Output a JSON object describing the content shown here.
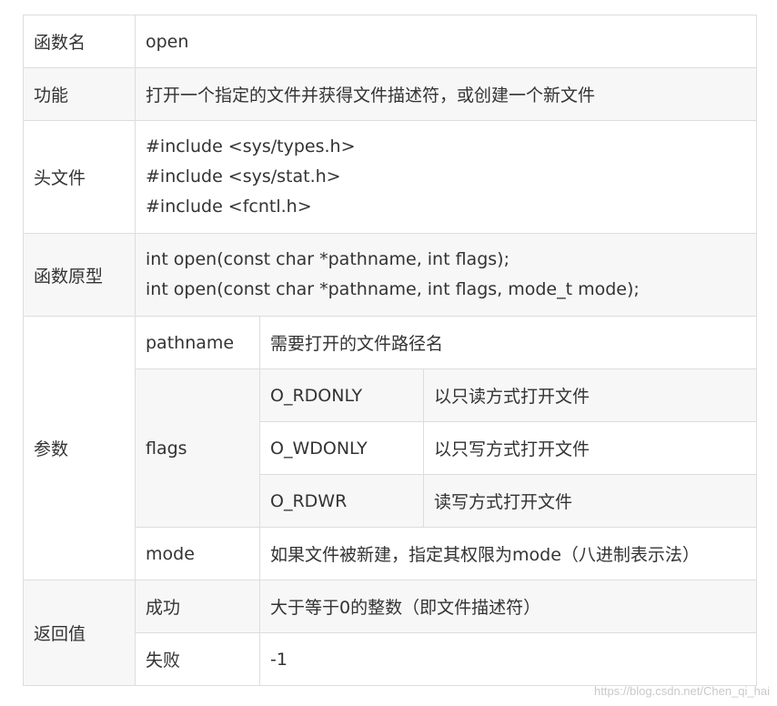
{
  "rows": {
    "name": {
      "label": "函数名",
      "value": "open"
    },
    "function": {
      "label": "功能",
      "value": "打开一个指定的文件并获得文件描述符，或创建一个新文件"
    },
    "headers": {
      "label": "头文件",
      "lines": [
        "#include <sys/types.h>",
        "#include <sys/stat.h>",
        "#include <fcntl.h>"
      ]
    },
    "prototype": {
      "label": "函数原型",
      "lines": [
        "int open(const char *pathname, int flags);",
        "int open(const char *pathname, int flags, mode_t mode);"
      ]
    },
    "params": {
      "label": "参数",
      "pathname": {
        "name": "pathname",
        "desc": "需要打开的文件路径名"
      },
      "flags": {
        "name": "flags",
        "options": [
          {
            "flag": "O_RDONLY",
            "desc": "以只读方式打开文件"
          },
          {
            "flag": "O_WDONLY",
            "desc": "以只写方式打开文件"
          },
          {
            "flag": "O_RDWR",
            "desc": "读写方式打开文件"
          }
        ]
      },
      "mode": {
        "name": "mode",
        "desc": "如果文件被新建，指定其权限为mode（八进制表示法）"
      }
    },
    "returns": {
      "label": "返回值",
      "success": {
        "name": "成功",
        "desc": "大于等于0的整数（即文件描述符）"
      },
      "failure": {
        "name": "失败",
        "desc": "-1"
      }
    }
  },
  "watermark": "https://blog.csdn.net/Chen_qi_hai"
}
